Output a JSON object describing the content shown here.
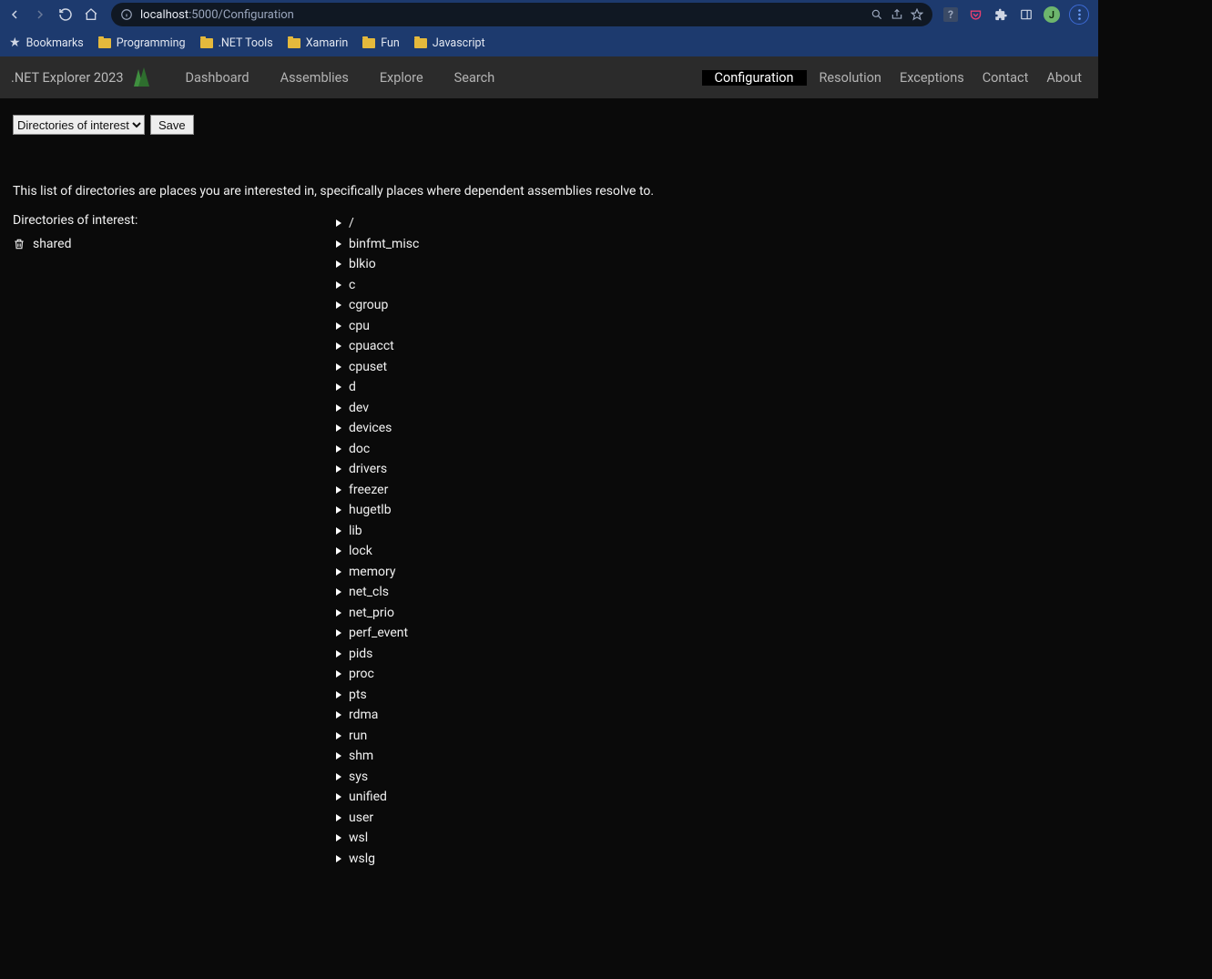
{
  "browser": {
    "url_host": "localhost",
    "url_port_path": ":5000/Configuration",
    "avatar_initial": "J",
    "bookmarks": [
      {
        "kind": "star",
        "label": "Bookmarks"
      },
      {
        "kind": "folder",
        "label": "Programming"
      },
      {
        "kind": "folder",
        "label": ".NET Tools"
      },
      {
        "kind": "folder",
        "label": "Xamarin"
      },
      {
        "kind": "folder",
        "label": "Fun"
      },
      {
        "kind": "folder",
        "label": "Javascript"
      }
    ]
  },
  "app": {
    "brand": ".NET Explorer 2023",
    "nav_left": [
      "Dashboard",
      "Assemblies",
      "Explore",
      "Search"
    ],
    "nav_right": [
      "Configuration",
      "Resolution",
      "Exceptions",
      "Contact",
      "About"
    ],
    "active_nav": "Configuration"
  },
  "page": {
    "select_options": [
      "Directories of interest"
    ],
    "select_value": "Directories of interest",
    "save_label": "Save",
    "description": "This list of directories are places you are interested in, specifically places where dependent assemblies resolve to.",
    "left_heading": "Directories of interest:",
    "interest_items": [
      "shared"
    ],
    "tree": [
      "/",
      "binfmt_misc",
      "blkio",
      "c",
      "cgroup",
      "cpu",
      "cpuacct",
      "cpuset",
      "d",
      "dev",
      "devices",
      "doc",
      "drivers",
      "freezer",
      "hugetlb",
      "lib",
      "lock",
      "memory",
      "net_cls",
      "net_prio",
      "perf_event",
      "pids",
      "proc",
      "pts",
      "rdma",
      "run",
      "shm",
      "sys",
      "unified",
      "user",
      "wsl",
      "wslg"
    ]
  }
}
